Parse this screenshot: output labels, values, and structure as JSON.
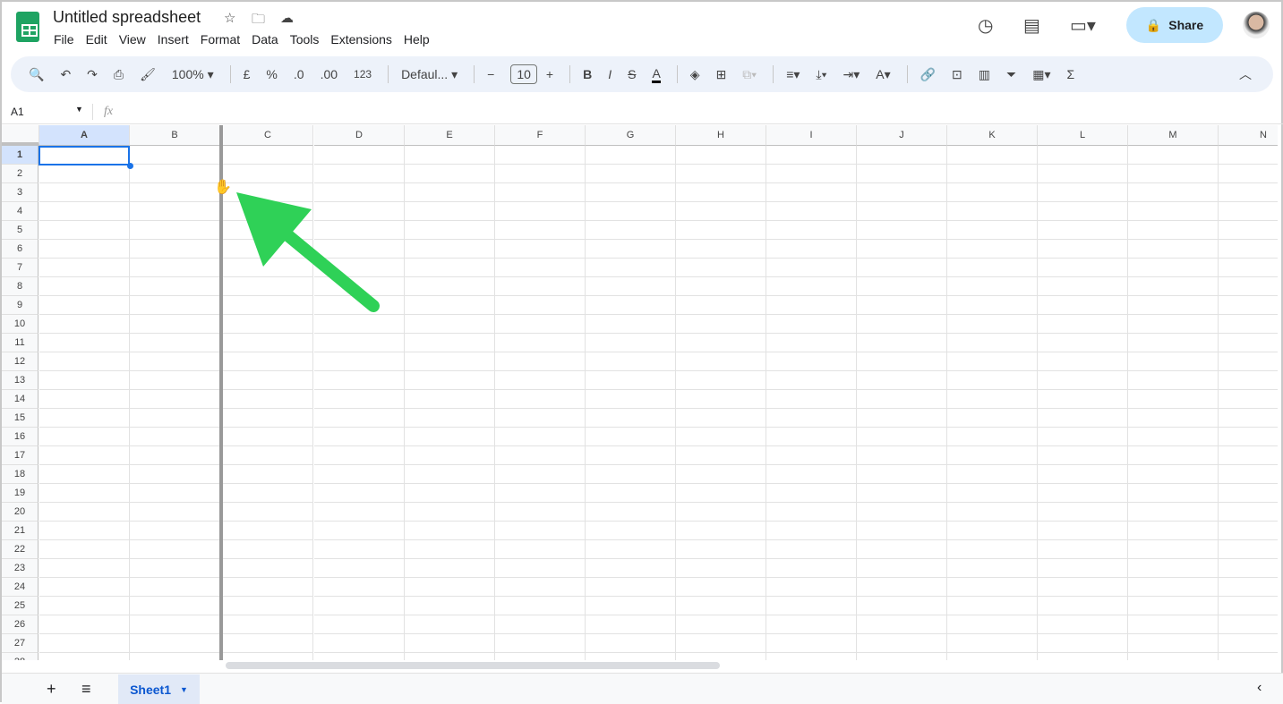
{
  "app": {
    "title": "Untitled spreadsheet",
    "share_label": "Share",
    "menu": [
      "File",
      "Edit",
      "View",
      "Insert",
      "Format",
      "Data",
      "Tools",
      "Extensions",
      "Help"
    ]
  },
  "toolbar": {
    "zoom": "100%",
    "currency": "£",
    "percent": "%",
    "dec_decrease": ".0",
    "dec_increase": ".00",
    "number_format": "123",
    "font": "Defaul...",
    "font_size": "10",
    "bold": "B",
    "italic": "I",
    "sum": "Σ"
  },
  "formula_bar": {
    "cell_ref": "A1",
    "fx": "fx",
    "value": ""
  },
  "grid": {
    "columns": [
      "A",
      "B",
      "C",
      "D",
      "E",
      "F",
      "G",
      "H",
      "I",
      "J",
      "K",
      "L",
      "M",
      "N"
    ],
    "row_count": 27,
    "selected_cell": "A1"
  },
  "sheets": [
    {
      "name": "Sheet1",
      "active": true
    }
  ],
  "annotation": {
    "arrow_color": "#2fd157"
  },
  "colors": {
    "accent": "#1a73e8",
    "share_bg": "#c2e7ff",
    "logo": "#1ea362"
  }
}
